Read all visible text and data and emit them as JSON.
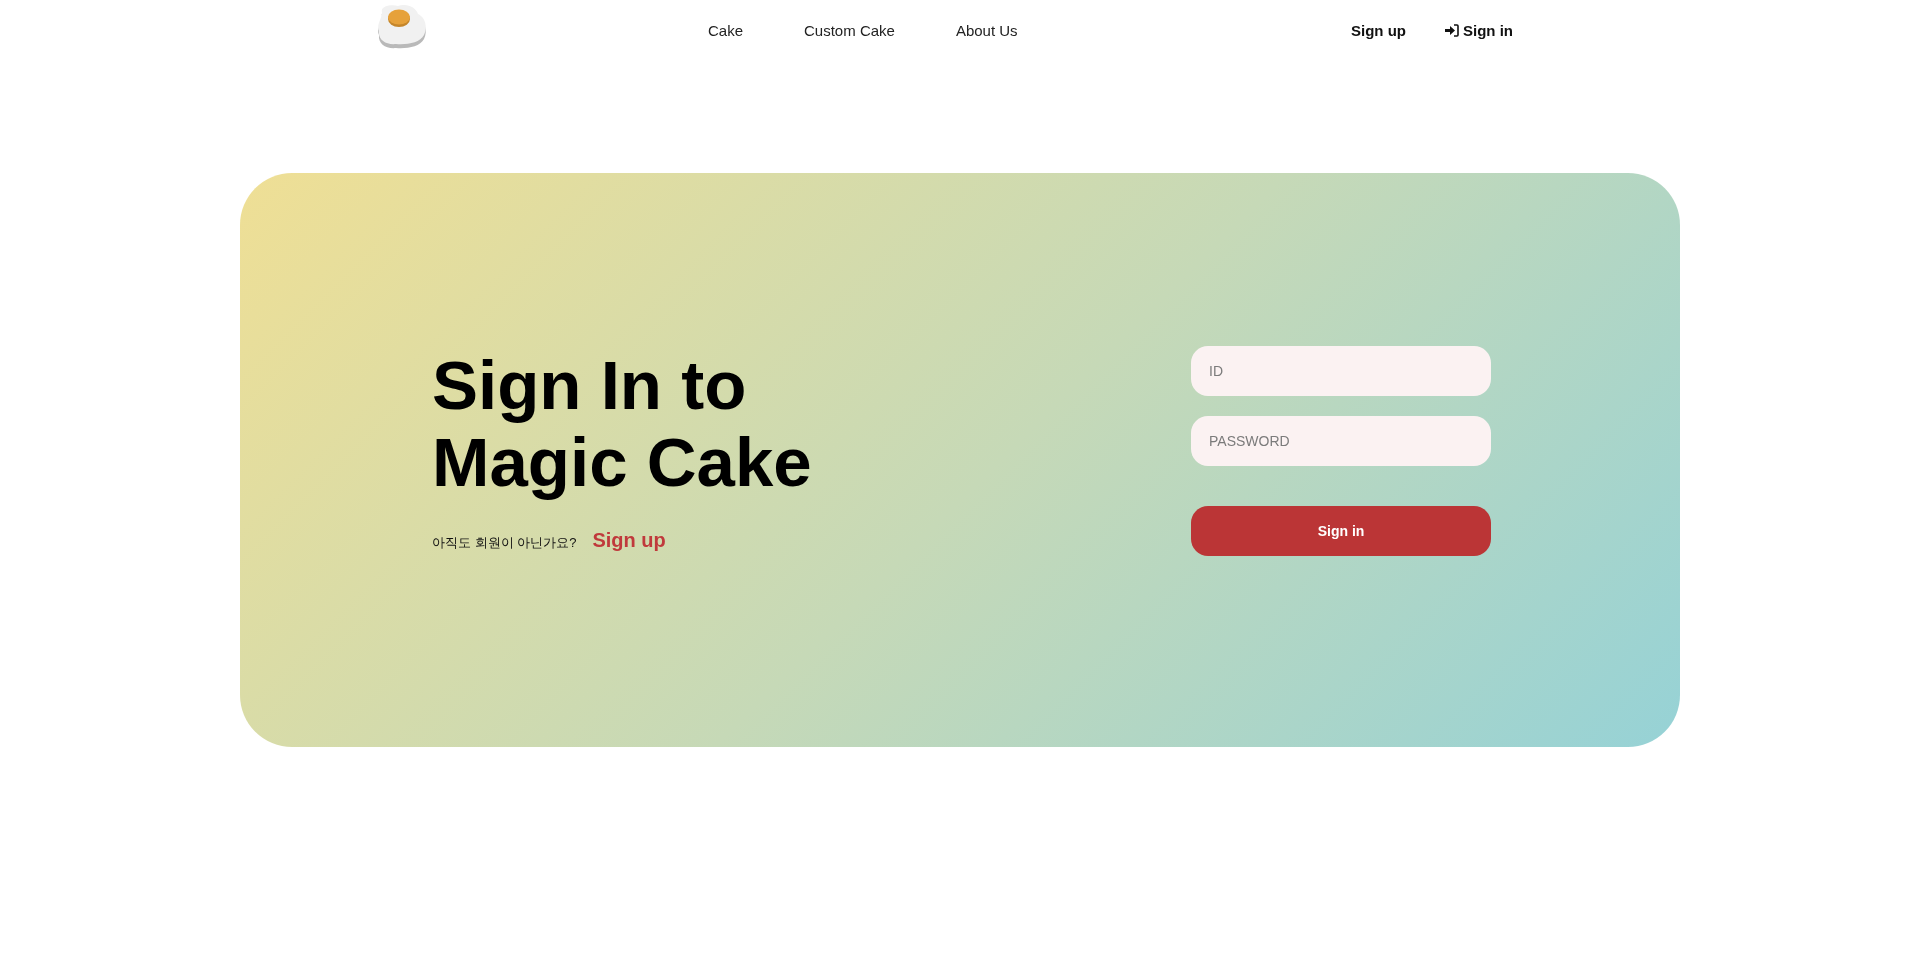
{
  "header": {
    "nav": [
      {
        "label": "Cake"
      },
      {
        "label": "Custom Cake"
      },
      {
        "label": "About Us"
      }
    ],
    "account_links": [
      {
        "label": "Sign up",
        "kind": "plain"
      },
      {
        "label": "Sign in",
        "kind": "with-icon"
      }
    ]
  },
  "signin_panel": {
    "title": "Sign In to Magic Cake",
    "signup_prompt": {
      "text": "아직도 회원이 아닌가요?",
      "link": "Sign up"
    },
    "fields": [
      {
        "placeholder": "ID"
      },
      {
        "placeholder": "PASSWORD"
      }
    ],
    "submit": "Sign in"
  }
}
